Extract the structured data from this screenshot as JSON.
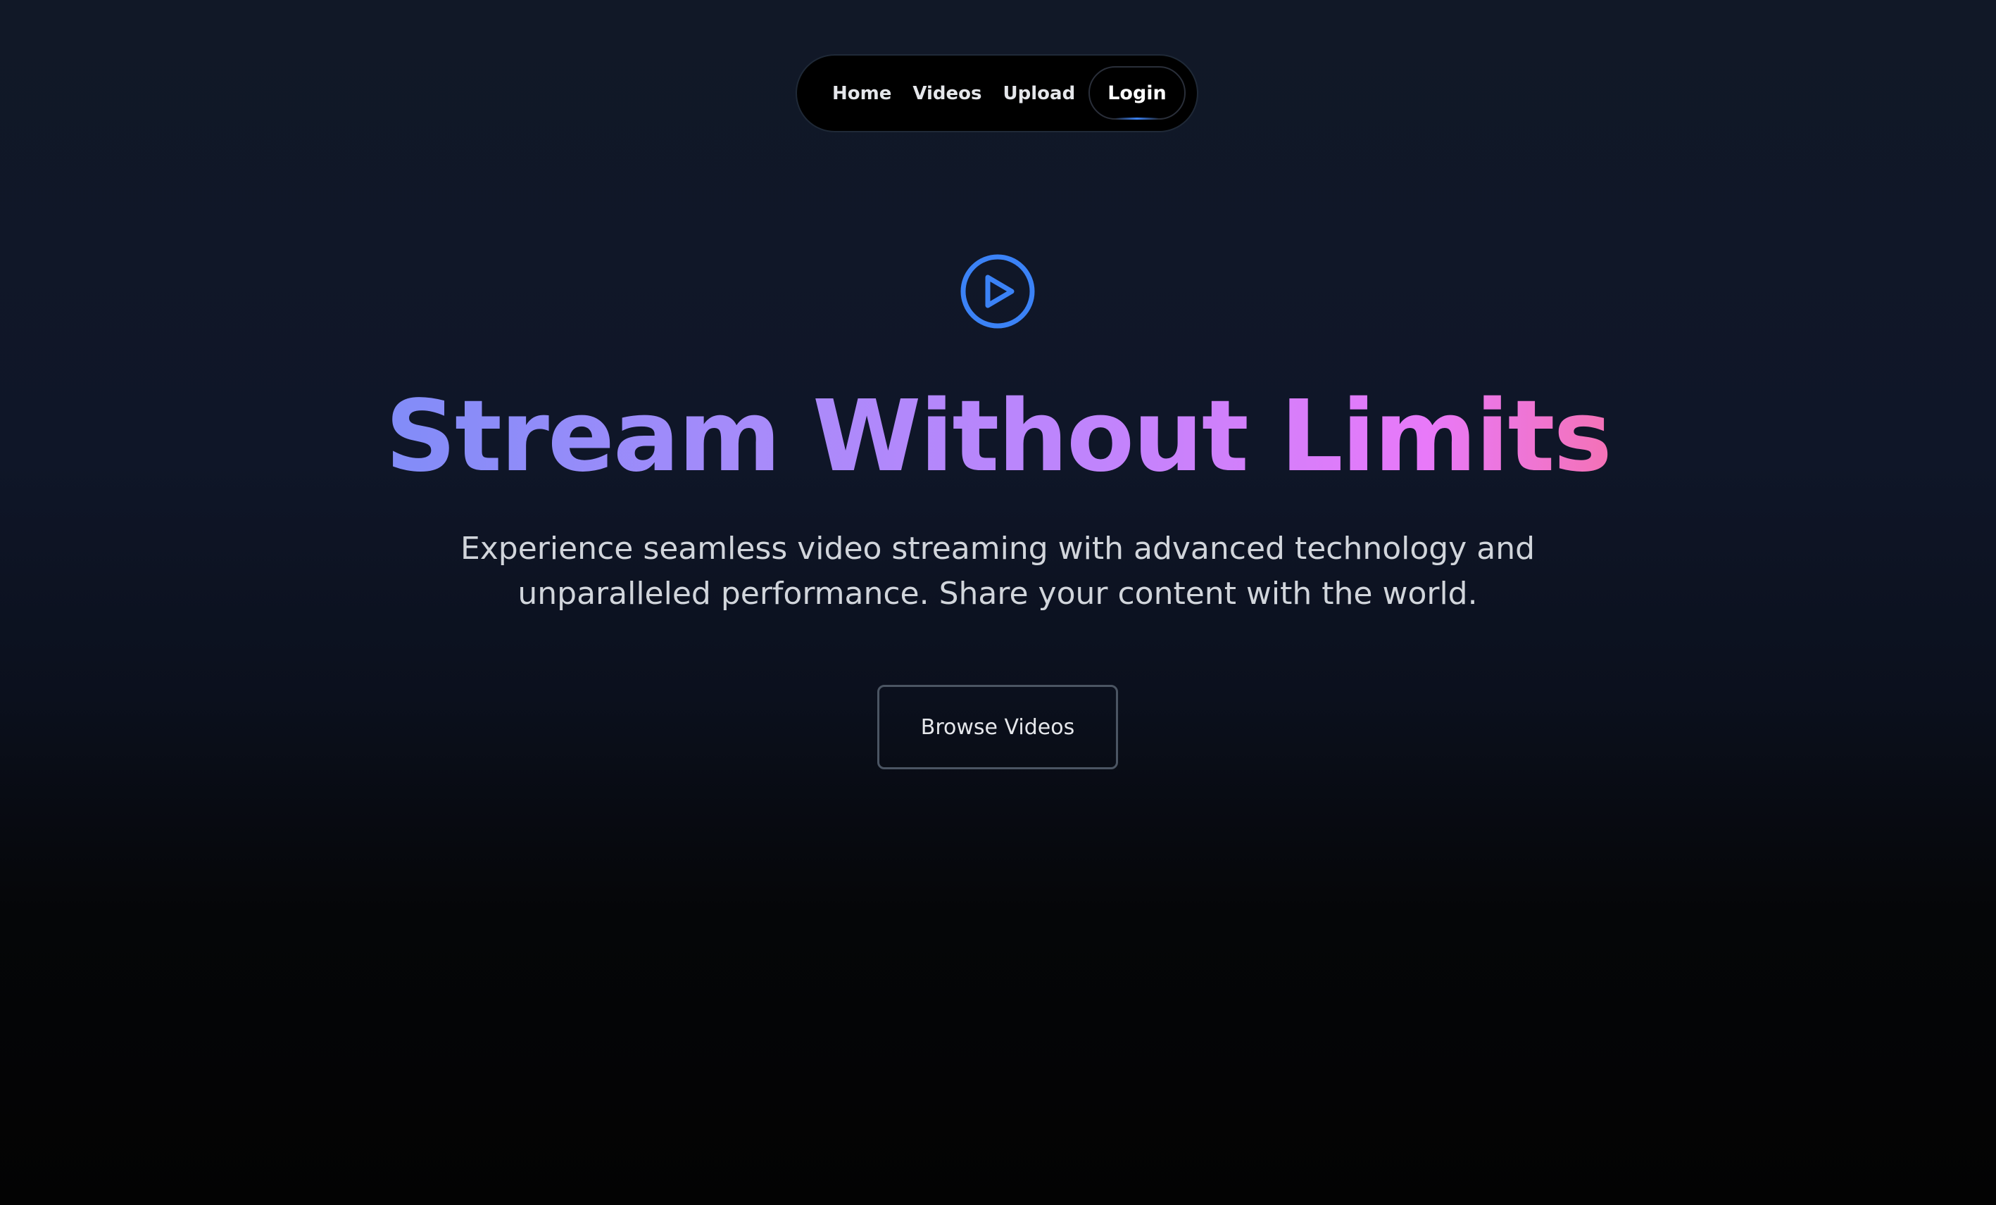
{
  "nav": {
    "links": [
      {
        "label": "Home"
      },
      {
        "label": "Videos"
      },
      {
        "label": "Upload"
      }
    ],
    "login_label": "Login"
  },
  "hero": {
    "icon": "play-circle-icon",
    "title": "Stream Without Limits",
    "subtitle_line1": "Experience seamless video streaming with advanced technology and",
    "subtitle_line2": "unparalleled performance. Share your content with the world.",
    "cta_label": "Browse Videos"
  },
  "colors": {
    "icon_blue": "#3b82f6",
    "title_gradient_start": "#818cf8",
    "title_gradient_end": "#f472b6",
    "background_top": "#111827",
    "background_bottom": "#030303"
  }
}
